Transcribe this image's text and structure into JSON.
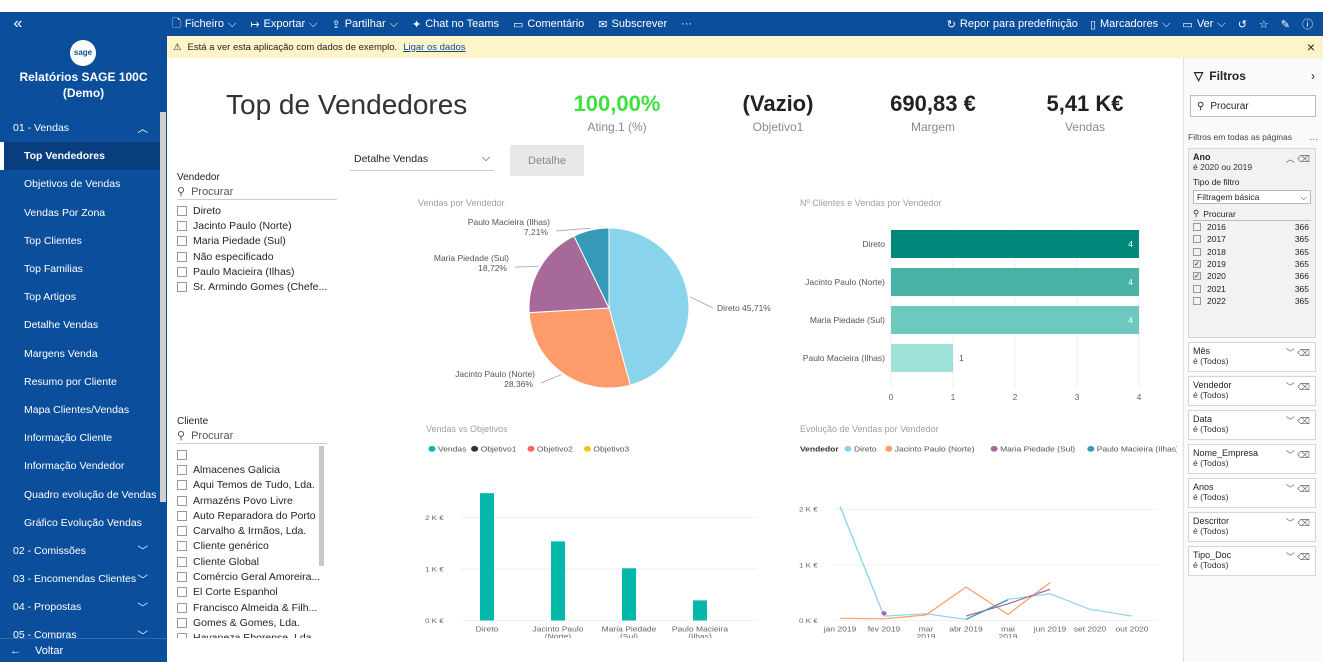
{
  "topbar": {
    "menu": [
      {
        "icon": "file-icon",
        "label": "Ficheiro",
        "caret": true
      },
      {
        "icon": "export-icon",
        "label": "Exportar",
        "caret": true
      },
      {
        "icon": "share-icon",
        "label": "Partilhar",
        "caret": true
      },
      {
        "icon": "teams-icon",
        "label": "Chat no Teams",
        "caret": false
      },
      {
        "icon": "comment-icon",
        "label": "Comentário",
        "caret": false
      },
      {
        "icon": "mail-icon",
        "label": "Subscrever",
        "caret": false
      }
    ],
    "more": "···",
    "right": {
      "reset": "Repor para predefinição",
      "bookmarks": "Marcadores",
      "view": "Ver"
    }
  },
  "sidebar": {
    "logo": "sage",
    "title_line1": "Relatórios SAGE 100C",
    "title_line2": "(Demo)",
    "items": [
      {
        "label": "01 - Vendas",
        "type": "section",
        "expanded": true
      },
      {
        "label": "Top Vendedores",
        "type": "page",
        "active": true
      },
      {
        "label": "Objetivos de Vendas",
        "type": "page"
      },
      {
        "label": "Vendas Por Zona",
        "type": "page"
      },
      {
        "label": "Top Clientes",
        "type": "page"
      },
      {
        "label": "Top Familias",
        "type": "page"
      },
      {
        "label": "Top Artigos",
        "type": "page"
      },
      {
        "label": "Detalhe Vendas",
        "type": "page"
      },
      {
        "label": "Margens Venda",
        "type": "page"
      },
      {
        "label": "Resumo por Cliente",
        "type": "page"
      },
      {
        "label": "Mapa Clientes/Vendas",
        "type": "page"
      },
      {
        "label": "Informação Cliente",
        "type": "page"
      },
      {
        "label": "Informação Vendedor",
        "type": "page"
      },
      {
        "label": "Quadro evolução de Vendas",
        "type": "page"
      },
      {
        "label": "Gráfico Evolução Vendas",
        "type": "page"
      },
      {
        "label": "02 - Comissões",
        "type": "section",
        "expanded": false
      },
      {
        "label": "03 - Encomendas Clientes",
        "type": "section",
        "expanded": false
      },
      {
        "label": "04 - Propostas",
        "type": "section",
        "expanded": false
      },
      {
        "label": "05 - Compras",
        "type": "section",
        "expanded": false
      }
    ],
    "back": "Voltar"
  },
  "banner": {
    "text": "Está a ver esta aplicação com dados de exemplo.",
    "link": "Ligar os dados"
  },
  "report": {
    "title": "Top de Vendedores",
    "kpis": [
      {
        "value": "100,00%",
        "label": "Ating.1 (%)",
        "color": "#3ee03e"
      },
      {
        "value": "(Vazio)",
        "label": "Objetivo1",
        "color": "#222222"
      },
      {
        "value": "690,83 €",
        "label": "Margem",
        "color": "#222222"
      },
      {
        "value": "5,41 K€",
        "label": "Vendas",
        "color": "#222222"
      }
    ],
    "dropdown": "Detalhe Vendas",
    "detail_button": "Detalhe",
    "vendedor_slicer": {
      "title": "Vendedor",
      "search": "Procurar",
      "options": [
        "Direto",
        "Jacinto Paulo (Norte)",
        "Maria Piedade (Sul)",
        "Não especificado",
        "Paulo Macieira (Ilhas)",
        "Sr. Armindo Gomes (Chefe..."
      ]
    },
    "cliente_slicer": {
      "title": "Cliente",
      "search": "Procurar",
      "options": [
        "",
        "Almacenes Galicia",
        "Aqui Temos de Tudo, Lda.",
        "Armazéns Povo Livre",
        "Auto Reparadora do Porto",
        "Carvalho & Irmãos, Lda.",
        "Cliente genérico",
        "Cliente Global",
        "Comércio Geral Amoreira...",
        "El Corte Espanhol",
        "Francisco Almeida & Filh...",
        "Gomes & Gomes, Lda.",
        "Havaneza Eborense, Lda."
      ]
    }
  },
  "filters": {
    "title": "Filtros",
    "search": "Procurar",
    "all_pages": "Filtros em todas as páginas",
    "ano": {
      "name": "Ano",
      "summary": "é 2020 ou 2019",
      "type_label": "Tipo de filtro",
      "type_value": "Filtragem básica",
      "search": "Procurar",
      "years": [
        {
          "year": "2016",
          "count": "366",
          "checked": false
        },
        {
          "year": "2017",
          "count": "365",
          "checked": false
        },
        {
          "year": "2018",
          "count": "365",
          "checked": false
        },
        {
          "year": "2019",
          "count": "365",
          "checked": true
        },
        {
          "year": "2020",
          "count": "366",
          "checked": true
        },
        {
          "year": "2021",
          "count": "365",
          "checked": false
        },
        {
          "year": "2022",
          "count": "365",
          "checked": false
        }
      ]
    },
    "cards": [
      {
        "name": "Mês",
        "summary": "é (Todos)"
      },
      {
        "name": "Vendedor",
        "summary": "é (Todos)"
      },
      {
        "name": "Data",
        "summary": "é (Todos)"
      },
      {
        "name": "Nome_Empresa",
        "summary": "é (Todos)"
      },
      {
        "name": "Anos",
        "summary": "é (Todos)"
      },
      {
        "name": "Descritor",
        "summary": "é (Todos)"
      },
      {
        "name": "Tipo_Doc",
        "summary": "é (Todos)"
      }
    ]
  },
  "chart_data": [
    {
      "type": "pie",
      "title": "Vendas por Vendedor",
      "slices": [
        {
          "name": "Direto",
          "value": 45.71,
          "label": "Direto 45,71%",
          "color": "#8ad4eb"
        },
        {
          "name": "Jacinto Paulo (Norte)",
          "value": 28.36,
          "label": "28,36%",
          "color": "#fd9b6a"
        },
        {
          "name": "Maria Piedade (Sul)",
          "value": 18.72,
          "label": "18,72%",
          "color": "#a66999"
        },
        {
          "name": "Paulo Macieira (Ilhas)",
          "value": 7.21,
          "label": "7,21%",
          "color": "#3599b8"
        }
      ]
    },
    {
      "type": "bar",
      "title": "Nº Clientes e Vendas por Vendedor",
      "categories": [
        "Direto",
        "Jacinto Paulo (Norte)",
        "Maria Piedade (Sul)",
        "Paulo Macieira (Ilhas)"
      ],
      "values": [
        4,
        4,
        4,
        1
      ],
      "colors": [
        "#00897b",
        "#48b2a5",
        "#6dc9bd",
        "#9fe2d9"
      ],
      "xlim": [
        0,
        4
      ],
      "xticks": [
        "0",
        "1",
        "2",
        "3",
        "4"
      ]
    },
    {
      "type": "bar",
      "title": "Vendas vs Objetivos",
      "legend": [
        {
          "name": "Vendas",
          "color": "#01b8aa"
        },
        {
          "name": "Objetivo1",
          "color": "#333333"
        },
        {
          "name": "Objetivo2",
          "color": "#fd625e"
        },
        {
          "name": "Objetivo3",
          "color": "#f2c80f"
        }
      ],
      "categories": [
        "Direto",
        "Jacinto Paulo (Norte)",
        "Maria Piedade (Sul)",
        "Paulo Macieira (Ilhas)"
      ],
      "cat_line1": [
        "Direto",
        "Jacinto Paulo",
        "Maria Piedade",
        "Paulo Macieira"
      ],
      "cat_line2": [
        "",
        "(Norte)",
        "(Sul)",
        "(Ilhas)"
      ],
      "values": [
        2470,
        1535,
        1013,
        390
      ],
      "ylim": [
        0,
        2700
      ],
      "yticks": [
        {
          "value": 0,
          "label": "0 K €"
        },
        {
          "value": 1000,
          "label": "1 K €"
        },
        {
          "value": 2000,
          "label": "2 K €"
        }
      ]
    },
    {
      "type": "line",
      "title": "Evolução de Vendas por Vendedor",
      "legend_title": "Vendedor",
      "x_line1": [
        "jan 2019",
        "fev 2019",
        "mar",
        "abr 2019",
        "mai",
        "jun 2019",
        "set 2020",
        "out 2020"
      ],
      "x_line2": [
        "",
        "",
        "2019",
        "",
        "2019",
        "",
        "",
        ""
      ],
      "ylim": [
        0,
        2500
      ],
      "yticks": [
        {
          "value": 0,
          "label": "0 K €"
        },
        {
          "value": 1000,
          "label": "1 K €"
        },
        {
          "value": 2000,
          "label": "2 K €"
        }
      ],
      "series": [
        {
          "name": "Direto",
          "color": "#8ad4eb",
          "values": [
            2050,
            80,
            120,
            20,
            380,
            480,
            200,
            80
          ]
        },
        {
          "name": "Jacinto Paulo (Norte)",
          "color": "#fd9b6a",
          "values": [
            40,
            30,
            100,
            600,
            110,
            680,
            null,
            null
          ]
        },
        {
          "name": "Maria Piedade (Sul)",
          "color": "#a66999",
          "values": [
            null,
            130,
            null,
            80,
            300,
            560,
            null,
            null
          ]
        },
        {
          "name": "Paulo Macieira (Ilhas)",
          "color": "#3599b8",
          "values": [
            null,
            null,
            null,
            20,
            370,
            null,
            null,
            null
          ]
        }
      ]
    }
  ]
}
